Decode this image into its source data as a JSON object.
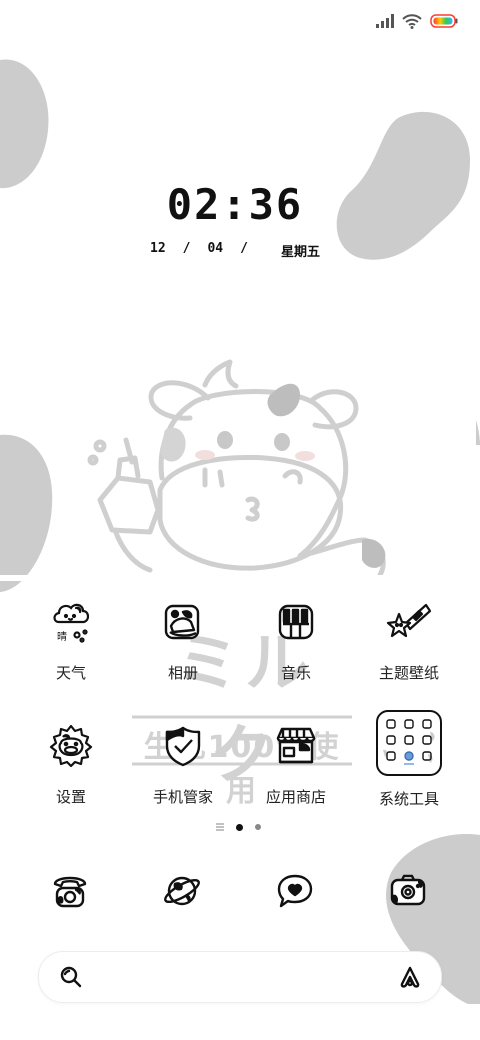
{
  "status_bar": {
    "icons": [
      "signal-icon",
      "wifi-icon",
      "battery-icon"
    ],
    "battery_colors": [
      "#ff3b30",
      "#ffcc00",
      "#34c759",
      "#2fb8ff"
    ]
  },
  "lockclock": {
    "time": "02:36",
    "date_month": "12",
    "date_sep1": "/",
    "date_day": "04",
    "date_sep2": "/",
    "weekday": "星期五"
  },
  "wallpaper": {
    "sign_text_1": "ミルク",
    "sign_text_2": "生乳100%使用",
    "spot_color": "#cccccc"
  },
  "apps": [
    {
      "label": "天气",
      "icon": "weather-cloud-icon"
    },
    {
      "label": "相册",
      "icon": "gallery-icon"
    },
    {
      "label": "音乐",
      "icon": "music-icon"
    },
    {
      "label": "主题壁纸",
      "icon": "themes-star-icon"
    },
    {
      "label": "设置",
      "icon": "settings-gear-icon"
    },
    {
      "label": "手机管家",
      "icon": "security-shield-icon"
    },
    {
      "label": "应用商店",
      "icon": "app-store-icon"
    },
    {
      "label": "系统工具",
      "icon": "system-tools-folder-icon"
    }
  ],
  "page_indicator": {
    "pages": 3,
    "current": 1
  },
  "dock": [
    {
      "icon": "phone-icon"
    },
    {
      "icon": "browser-planet-icon"
    },
    {
      "icon": "messages-heart-icon"
    },
    {
      "icon": "camera-icon"
    }
  ],
  "search": {
    "left_icon": "search-icon",
    "right_icon": "assistant-icon"
  }
}
